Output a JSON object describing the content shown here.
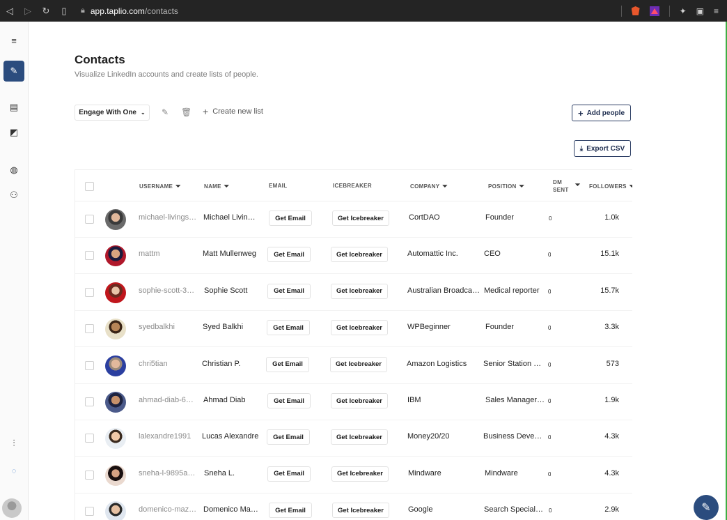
{
  "browser": {
    "url_host": "app.taplio.com",
    "url_path": "/contacts"
  },
  "colors": {
    "accent": "#2b4c7e",
    "outline": "#2b3d63"
  },
  "page": {
    "title": "Contacts",
    "subtitle": "Visualize LinkedIn accounts and create lists of people."
  },
  "toolbar": {
    "list_name": "Engage With One",
    "create_list": "Create new list",
    "add_people": "Add people",
    "export_csv": "Export CSV"
  },
  "table": {
    "headers": {
      "username": "USERNAME",
      "name": "NAME",
      "email": "EMAIL",
      "icebreaker": "ICEBREAKER",
      "company": "COMPANY",
      "position": "POSITION",
      "dm_line1": "DM",
      "dm_line2": "SENT",
      "followers": "FOLLOWERS"
    },
    "email_label": "Get Email",
    "icebreaker_label": "Get Icebreaker",
    "rows": [
      {
        "username": "michael-livings…",
        "name": "Michael Livin…",
        "company": "CortDAO",
        "position": "Founder",
        "dm": "0",
        "followers": "1.0k"
      },
      {
        "username": "mattm",
        "name": "Matt Mullenweg",
        "company": "Automattic Inc.",
        "position": "CEO",
        "dm": "0",
        "followers": "15.1k"
      },
      {
        "username": "sophie-scott-3…",
        "name": "Sophie Scott",
        "company": "Australian Broadca…",
        "position": "Medical reporter",
        "dm": "0",
        "followers": "15.7k"
      },
      {
        "username": "syedbalkhi",
        "name": "Syed Balkhi",
        "company": "WPBeginner",
        "position": "Founder",
        "dm": "0",
        "followers": "3.3k"
      },
      {
        "username": "chri5tian",
        "name": "Christian P.",
        "company": "Amazon Logistics",
        "position": "Senior Station …",
        "dm": "0",
        "followers": "573"
      },
      {
        "username": "ahmad-diab-6…",
        "name": "Ahmad Diab",
        "company": "IBM",
        "position": "Sales Manager …",
        "dm": "0",
        "followers": "1.9k"
      },
      {
        "username": "lalexandre1991",
        "name": "Lucas Alexandre",
        "company": "Money20/20",
        "position": "Business Devel…",
        "dm": "0",
        "followers": "4.3k"
      },
      {
        "username": "sneha-l-9895a…",
        "name": "Sneha L.",
        "company": "Mindware",
        "position": "Mindware",
        "dm": "0",
        "followers": "4.3k"
      },
      {
        "username": "domenico-maz…",
        "name": "Domenico Ma…",
        "company": "Google",
        "position": "Search Speciali…",
        "dm": "0",
        "followers": "2.9k"
      }
    ]
  }
}
